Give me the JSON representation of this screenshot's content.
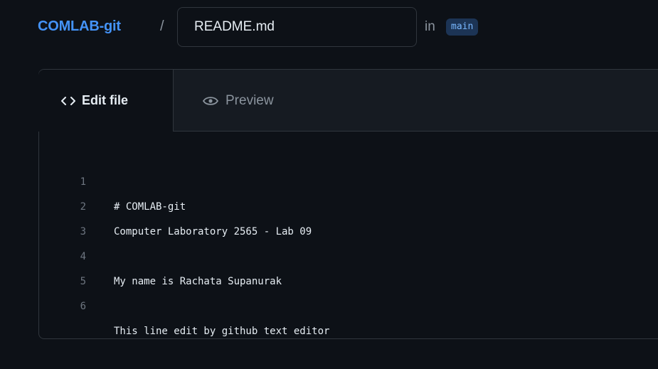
{
  "header": {
    "repo_name": "COMLAB-git",
    "separator": "/",
    "filename": "README.md",
    "in_label": "in",
    "branch": "main"
  },
  "tabs": [
    {
      "label": "Edit file",
      "icon": "code-icon",
      "active": true
    },
    {
      "label": "Preview",
      "icon": "eye-icon",
      "active": false
    }
  ],
  "editor": {
    "lines": [
      {
        "number": "1",
        "text": "# COMLAB-git"
      },
      {
        "number": "2",
        "text": "Computer Laboratory 2565 - Lab 09"
      },
      {
        "number": "3",
        "text": ""
      },
      {
        "number": "4",
        "text": "My name is Rachata Supanurak"
      },
      {
        "number": "5",
        "text": ""
      },
      {
        "number": "6",
        "text": "This line edit by github text editor"
      }
    ]
  },
  "colors": {
    "background": "#0d1117",
    "accent": "#4493f8",
    "border": "#30363d",
    "branch_badge_bg": "#1c3455",
    "muted_text": "#8b949e"
  }
}
